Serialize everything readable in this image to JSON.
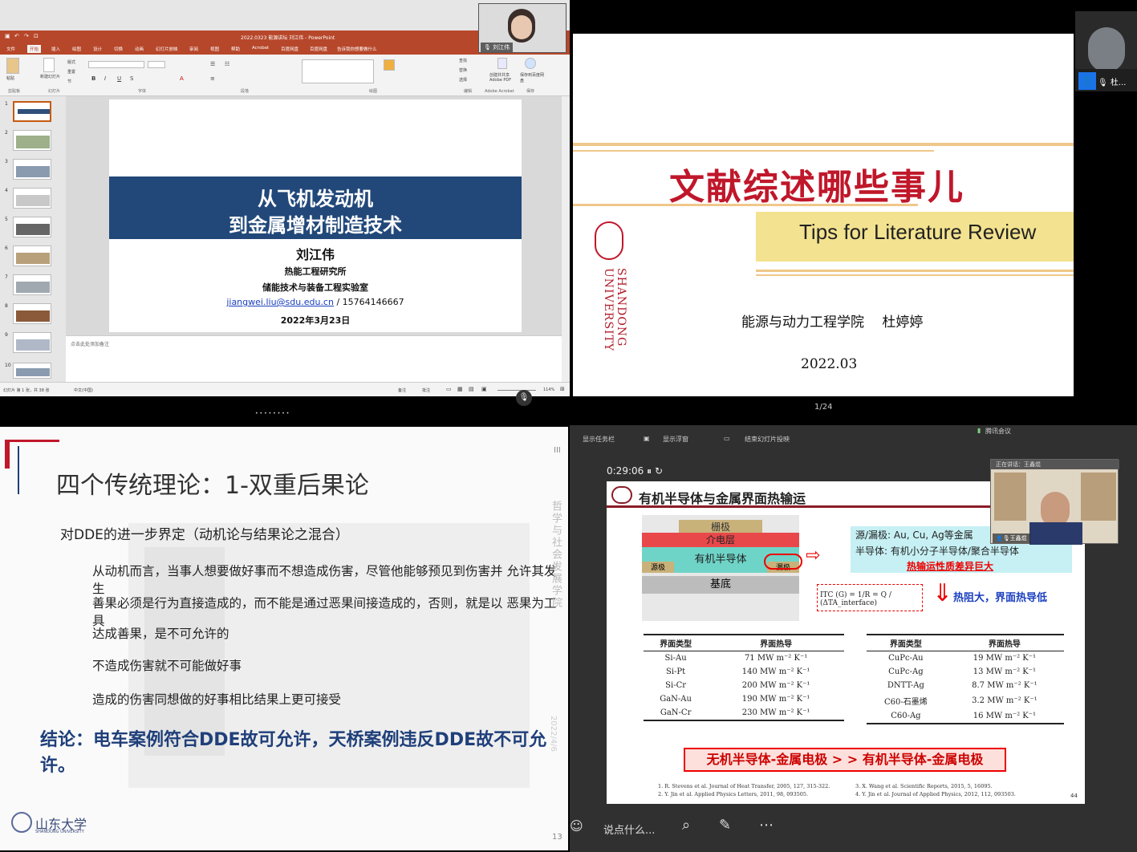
{
  "q1": {
    "window_title": "2022.0323 能源讲坛 刘江伟 - PowerPoint",
    "tabs": [
      "文件",
      "开始",
      "插入",
      "绘图",
      "设计",
      "切换",
      "动画",
      "幻灯片放映",
      "审阅",
      "视图",
      "帮助",
      "Acrobat",
      "百度网盘",
      "百度网盘"
    ],
    "tell_me": "告诉我你想要做什么",
    "ribbon_groups": [
      "剪贴板",
      "幻灯片",
      "字体",
      "段落",
      "绘图",
      "编辑",
      "Adobe Acrobat",
      "保存"
    ],
    "ribbon_tools": {
      "paste": "粘贴",
      "new_slide": "新建幻灯片",
      "reset": "重置",
      "section": "节",
      "find": "查找",
      "replace": "替换",
      "select": "选择",
      "create_pdf": "创建并共享 Adobe PDF",
      "save_baidu": "保存到百度网盘",
      "layout": "版式"
    },
    "thumb_numbers": [
      "1",
      "2",
      "3",
      "4",
      "5",
      "6",
      "7",
      "8",
      "9",
      "10"
    ],
    "slide": {
      "title_line1": "从飞机发动机",
      "title_line2": "到金属增材制造技术",
      "author": "刘江伟",
      "affil1": "热能工程研究所",
      "affil2": "储能技术与装备工程实验室",
      "email": "jiangwei.liu@sdu.edu.cn",
      "phone": " / 15764146667",
      "date": "2022年3月23日"
    },
    "notes_placeholder": "点击此处添加备注",
    "status": {
      "slide_count": "幻灯片 第 1 张，共 38 张",
      "lang": "中文(中国)",
      "notes": "备注",
      "comments": "批注",
      "zoom": "114%"
    },
    "video_name": "刘江伟"
  },
  "dots": "••••••••",
  "q2": {
    "title": "文献综述哪些事儿",
    "subtitle": "Tips for Literature Review",
    "university": "SHANDONG UNIVERSITY",
    "dept_name": "能源与动力工程学院　 杜婷婷",
    "date": "2022.03",
    "page": "1/24",
    "video_name": "杜..."
  },
  "q3": {
    "heading": "四个传统理论：1-双重后果论",
    "sub": "对DDE的进一步界定（动机论与结果论之混合）",
    "p1": "从动机而言，当事人想要做好事而不想造成伤害，尽管他能够预见到伤害并 允许其发生",
    "p2": "善果必须是行为直接造成的，而不能是通过恶果间接造成的，否则，就是以 恶果为工具",
    "p3": "达成善果，是不可允许的",
    "p4": "不造成伤害就不可能做好事",
    "p5": "造成的伤害同想做的好事相比结果上更可接受",
    "conclusion": "结论：电车案例符合DDE故可允许，天桥案例违反DDE故不可允许。",
    "vertical": "哲学与社会发展学院",
    "vdate": "2022/4/6",
    "logo_text": "山东大学",
    "logo_sub": "SHANDONG UNIVERSITY",
    "page": "13",
    "corner": "III"
  },
  "q4": {
    "toolbar": [
      "显示任务栏",
      "显示浮窗",
      "结束幻灯片投映"
    ],
    "app": "腾讯会议",
    "timer": "0:29:06",
    "title": "有机半导体与金属界面热输运",
    "diagram": {
      "gate": "栅极",
      "dielectric": "介电层",
      "osc": "有机半导体",
      "source": "源极",
      "drain": "漏极",
      "substrate": "基底"
    },
    "info": {
      "line1": "源/漏极: Au, Cu, Ag等金属",
      "line2": "半导体: 有机小分子半导体/聚合半导体",
      "line3": "热输运性质差异巨大"
    },
    "formula": "ITC (G) = 1/R = Q / (ΔTA_interface)",
    "thermal": "热阻大，界面热导低",
    "table_headers": [
      "界面类型",
      "界面热导"
    ],
    "table_left": [
      [
        "Si-Au",
        "71 MW m⁻² K⁻¹"
      ],
      [
        "Si-Pt",
        "140 MW m⁻² K⁻¹"
      ],
      [
        "Si-Cr",
        "200 MW m⁻² K⁻¹"
      ],
      [
        "GaN-Au",
        "190 MW m⁻² K⁻¹"
      ],
      [
        "GaN-Cr",
        "230 MW m⁻² K⁻¹"
      ]
    ],
    "table_right": [
      [
        "CuPc-Au",
        "19 MW m⁻² K⁻¹"
      ],
      [
        "CuPc-Ag",
        "13 MW m⁻² K⁻¹"
      ],
      [
        "DNTT-Ag",
        "8.7 MW m⁻² K⁻¹"
      ],
      [
        "C60-石墨烯",
        "3.2 MW m⁻² K⁻¹"
      ],
      [
        "C60-Ag",
        "16 MW m⁻² K⁻¹"
      ]
    ],
    "conclusion": "无机半导体-金属电极 > > 有机半导体-金属电极",
    "refs": [
      "1. R. Stevens et al. Journal of Heat Transfer, 2005, 127, 315-322.",
      "2. Y. Jin et al. Applied Physics Letters, 2011, 98, 093505.",
      "3. X. Wang et al. Scientific Reports, 2015, 5, 16095.",
      "4. Y. Jin et al. Journal of Applied Physics, 2012, 112, 093503."
    ],
    "page": "44",
    "video_name": "王鑫焜",
    "video_top": "正在讲话：王鑫焜",
    "chat": "说点什么..."
  },
  "colors": {
    "ppt_red": "#b7472a",
    "title_blue": "#22487a",
    "lit_red": "#c0172a",
    "concl_blue": "#1f3f7a",
    "bg": "#000000"
  }
}
